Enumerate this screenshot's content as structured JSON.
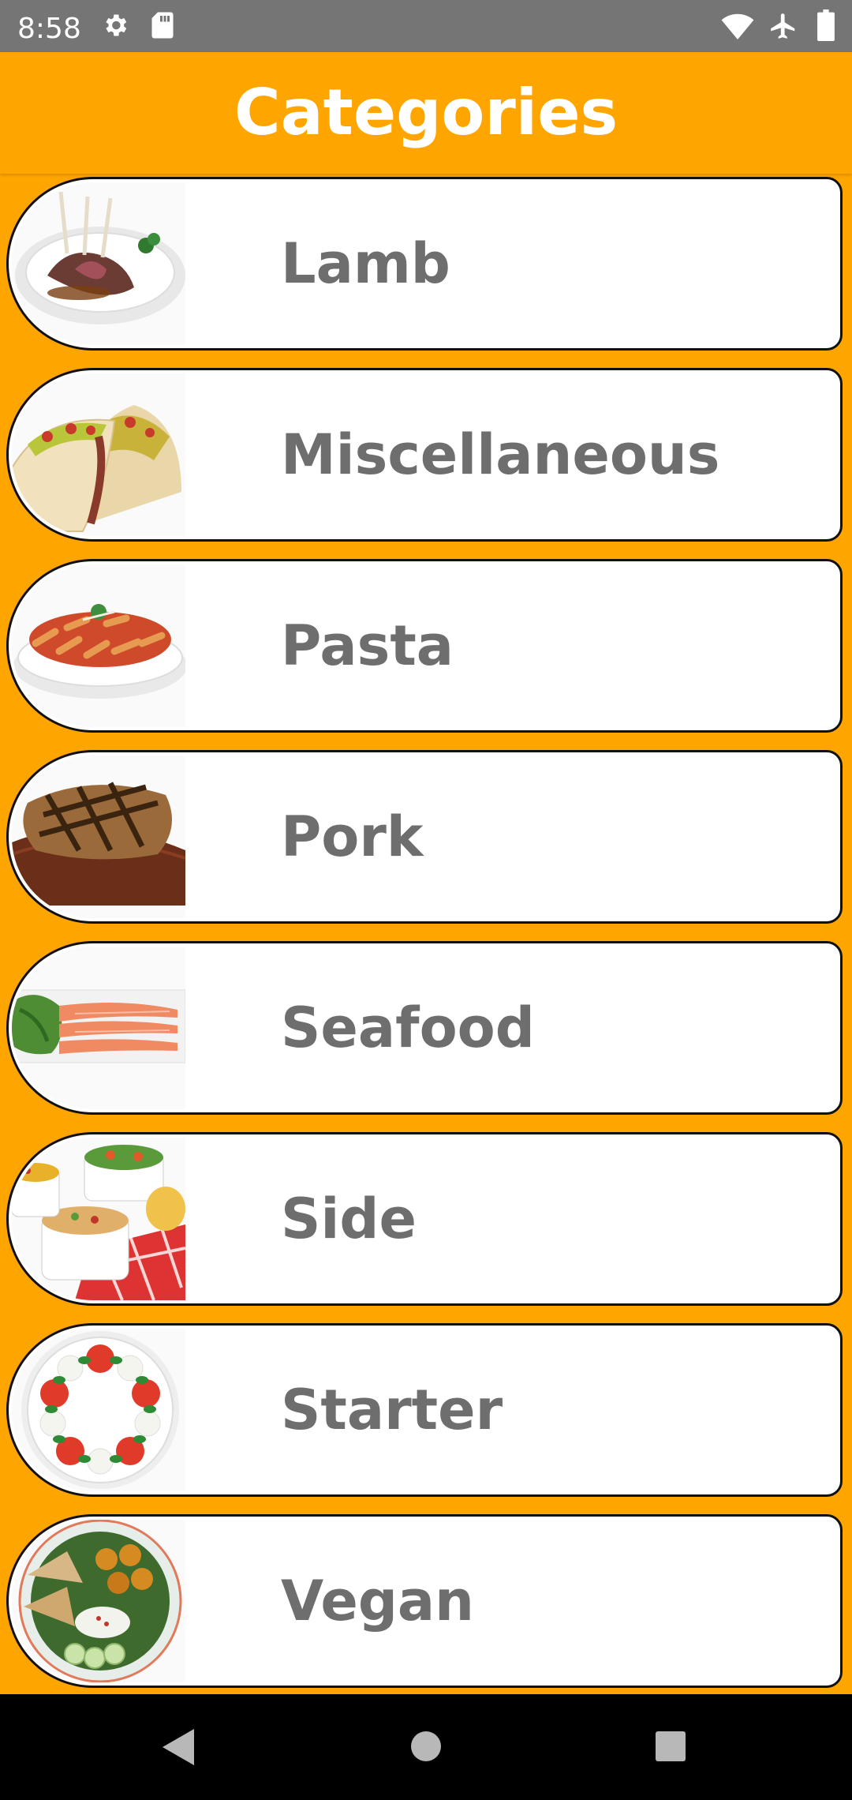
{
  "status": {
    "time": "8:58",
    "icons": [
      "gear-icon",
      "sd-card-icon",
      "wifi-icon",
      "airplane-icon",
      "battery-icon"
    ]
  },
  "header": {
    "title": "Categories"
  },
  "colors": {
    "accent": "#FFA500",
    "label": "#6e6e6e",
    "status_bar": "#757575"
  },
  "categories": [
    {
      "label": "Lamb",
      "image": "lamb-chops"
    },
    {
      "label": "Miscellaneous",
      "image": "tacos"
    },
    {
      "label": "Pasta",
      "image": "penne-pasta"
    },
    {
      "label": "Pork",
      "image": "pork-chop"
    },
    {
      "label": "Seafood",
      "image": "smoked-salmon"
    },
    {
      "label": "Side",
      "image": "side-dishes"
    },
    {
      "label": "Starter",
      "image": "caprese-salad"
    },
    {
      "label": "Vegan",
      "image": "vegan-bowl"
    }
  ],
  "nav": {
    "icons": [
      "back-icon",
      "home-icon",
      "recents-icon"
    ]
  }
}
